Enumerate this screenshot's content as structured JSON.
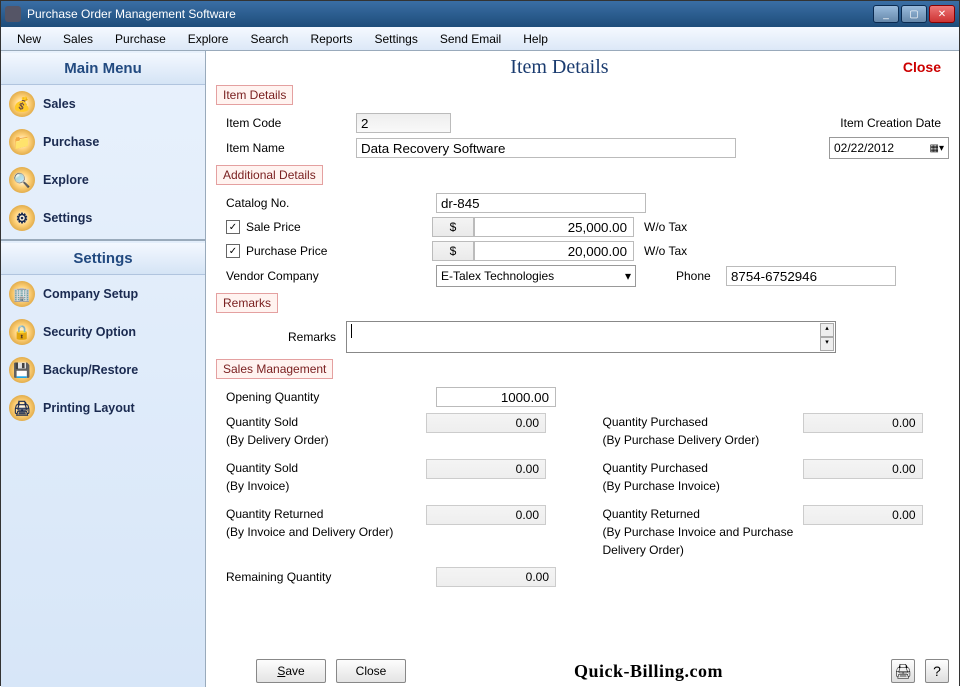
{
  "window": {
    "title": "Purchase Order Management Software"
  },
  "menu": [
    "New",
    "Sales",
    "Purchase",
    "Explore",
    "Search",
    "Reports",
    "Settings",
    "Send Email",
    "Help"
  ],
  "sidebar": {
    "main_header": "Main Menu",
    "main_items": [
      "Sales",
      "Purchase",
      "Explore",
      "Settings"
    ],
    "settings_header": "Settings",
    "settings_items": [
      "Company Setup",
      "Security Option",
      "Backup/Restore",
      "Printing Layout"
    ]
  },
  "page": {
    "title": "Item Details",
    "close_label": "Close"
  },
  "sections": {
    "item_details": "Item Details",
    "additional": "Additional Details",
    "remarks": "Remarks",
    "sales_mgmt": "Sales Management"
  },
  "labels": {
    "item_code": "Item Code",
    "item_name": "Item Name",
    "creation_date": "Item Creation Date",
    "catalog_no": "Catalog No.",
    "sale_price": "Sale Price",
    "purchase_price": "Purchase Price",
    "wo_tax": "W/o Tax",
    "vendor_company": "Vendor Company",
    "phone": "Phone",
    "remarks": "Remarks",
    "opening_qty": "Opening Quantity",
    "qty_sold": "Quantity Sold",
    "by_delivery": "(By Delivery Order)",
    "qty_purchased": "Quantity Purchased",
    "by_pdo": "(By Purchase Delivery Order)",
    "by_invoice": "(By Invoice)",
    "by_pinvoice": "(By Purchase Invoice)",
    "qty_returned": "Quantity Returned",
    "by_inv_do": "(By Invoice and Delivery Order)",
    "by_pi_pdo": "(By Purchase Invoice and Purchase Delivery Order)",
    "remaining_qty": "Remaining Quantity"
  },
  "values": {
    "item_code": "2",
    "item_name": "Data Recovery Software",
    "creation_date": "02/22/2012",
    "catalog_no": "dr-845",
    "currency": "$",
    "sale_price": "25,000.00",
    "purchase_price": "20,000.00",
    "vendor_company": "E-Talex Technologies",
    "phone": "8754-6752946",
    "remarks": "",
    "opening_qty": "1000.00",
    "qty_sold_do": "0.00",
    "qty_purch_do": "0.00",
    "qty_sold_inv": "0.00",
    "qty_purch_inv": "0.00",
    "qty_ret_sales": "0.00",
    "qty_ret_purch": "0.00",
    "remaining_qty": "0.00"
  },
  "buttons": {
    "save": "Save",
    "close": "Close"
  },
  "watermark": "Quick-Billing.com"
}
